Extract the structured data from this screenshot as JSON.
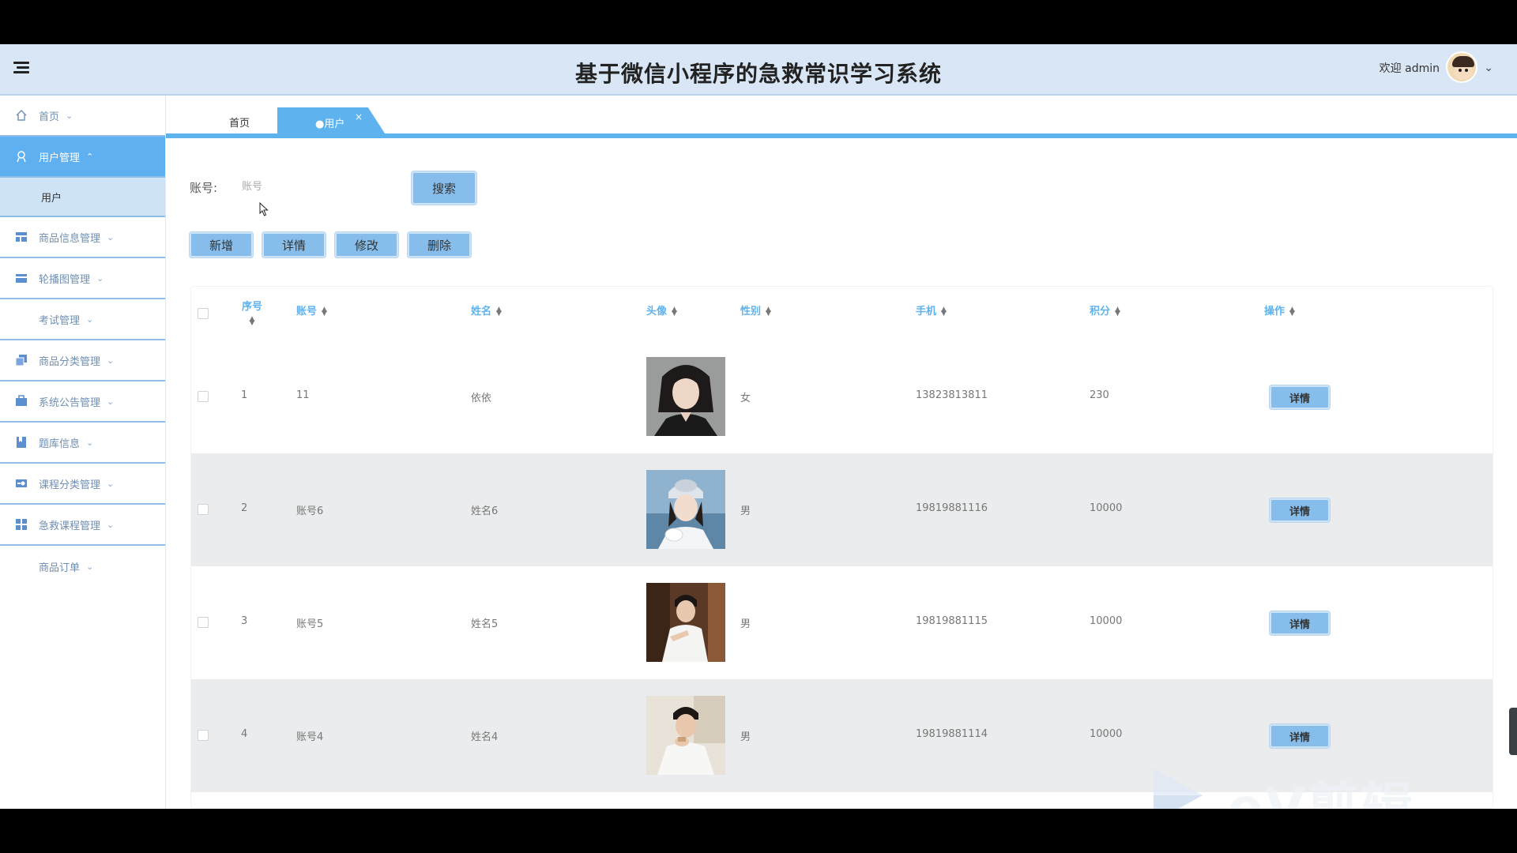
{
  "header": {
    "title": "基于微信小程序的急救常识学习系统",
    "welcome": "欢迎 admin",
    "menu_icon": "hamburger-icon",
    "user_caret": "⌄"
  },
  "sidebar": {
    "items": [
      {
        "label": "首页",
        "icon": "home-icon",
        "caret": "⌄"
      },
      {
        "label": "用户管理",
        "icon": "user-icon",
        "caret": "⌃"
      },
      {
        "label": "用户"
      },
      {
        "label": "商品信息管理",
        "icon": "layout-icon",
        "caret": "⌄"
      },
      {
        "label": "轮播图管理",
        "icon": "carousel-icon",
        "caret": "⌄"
      },
      {
        "label": "考试管理",
        "caret": "⌄"
      },
      {
        "label": "商品分类管理",
        "icon": "copy-icon",
        "caret": "⌄"
      },
      {
        "label": "系统公告管理",
        "icon": "briefcase-icon",
        "caret": "⌄"
      },
      {
        "label": "题库信息",
        "icon": "bookmark-icon",
        "caret": "⌄"
      },
      {
        "label": "课程分类管理",
        "icon": "card-icon",
        "caret": "⌄"
      },
      {
        "label": "急救课程管理",
        "icon": "grid-icon",
        "caret": "⌄"
      },
      {
        "label": "商品订单",
        "caret": "⌄"
      }
    ]
  },
  "tabs": {
    "home": "首页",
    "current": "●用户",
    "close": "×"
  },
  "search": {
    "label": "账号:",
    "placeholder": "账号",
    "button": "搜索"
  },
  "toolbar": {
    "add": "新增",
    "detail": "详情",
    "edit": "修改",
    "delete": "删除"
  },
  "table": {
    "columns": [
      "序号",
      "账号",
      "姓名",
      "头像",
      "性别",
      "手机",
      "积分",
      "操作"
    ],
    "rows": [
      {
        "index": "1",
        "account": "11",
        "name": "依依",
        "gender": "女",
        "phone": "13823813811",
        "points": "230",
        "action": "详情"
      },
      {
        "index": "2",
        "account": "账号6",
        "name": "姓名6",
        "gender": "男",
        "phone": "19819881116",
        "points": "10000",
        "action": "详情"
      },
      {
        "index": "3",
        "account": "账号5",
        "name": "姓名5",
        "gender": "男",
        "phone": "19819881115",
        "points": "10000",
        "action": "详情"
      },
      {
        "index": "4",
        "account": "账号4",
        "name": "姓名4",
        "gender": "男",
        "phone": "19819881114",
        "points": "10000",
        "action": "详情"
      }
    ]
  },
  "watermark": {
    "text": "eV剪辑"
  },
  "colors": {
    "header_bg": "#d9e6f5",
    "accent": "#5eb3ef",
    "button": "#86bdea",
    "row_alt": "#ebeced",
    "sidebar_text": "#6f8fb3"
  }
}
